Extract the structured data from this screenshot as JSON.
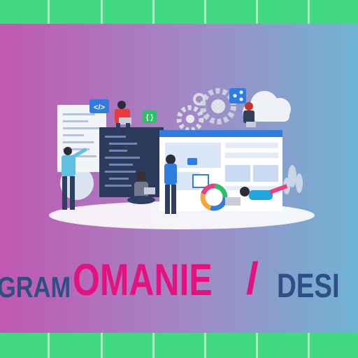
{
  "banner": {
    "headline_part1": "GRAM",
    "headline_part2": "OMANIE",
    "headline_slash": "/",
    "headline_part3": "DESI"
  },
  "illustration": {
    "code_tag": "</>",
    "braces_tag": "{ }",
    "icons": [
      "code-icon",
      "braces-icon",
      "share-icon",
      "cloud-icon",
      "gear-icon",
      "camera-icon",
      "image-icon",
      "donut-chart-icon"
    ]
  },
  "colors": {
    "stripe_green": "#41d980",
    "headline_pink": "#e4127f",
    "headline_navy": "#2e4f86"
  }
}
